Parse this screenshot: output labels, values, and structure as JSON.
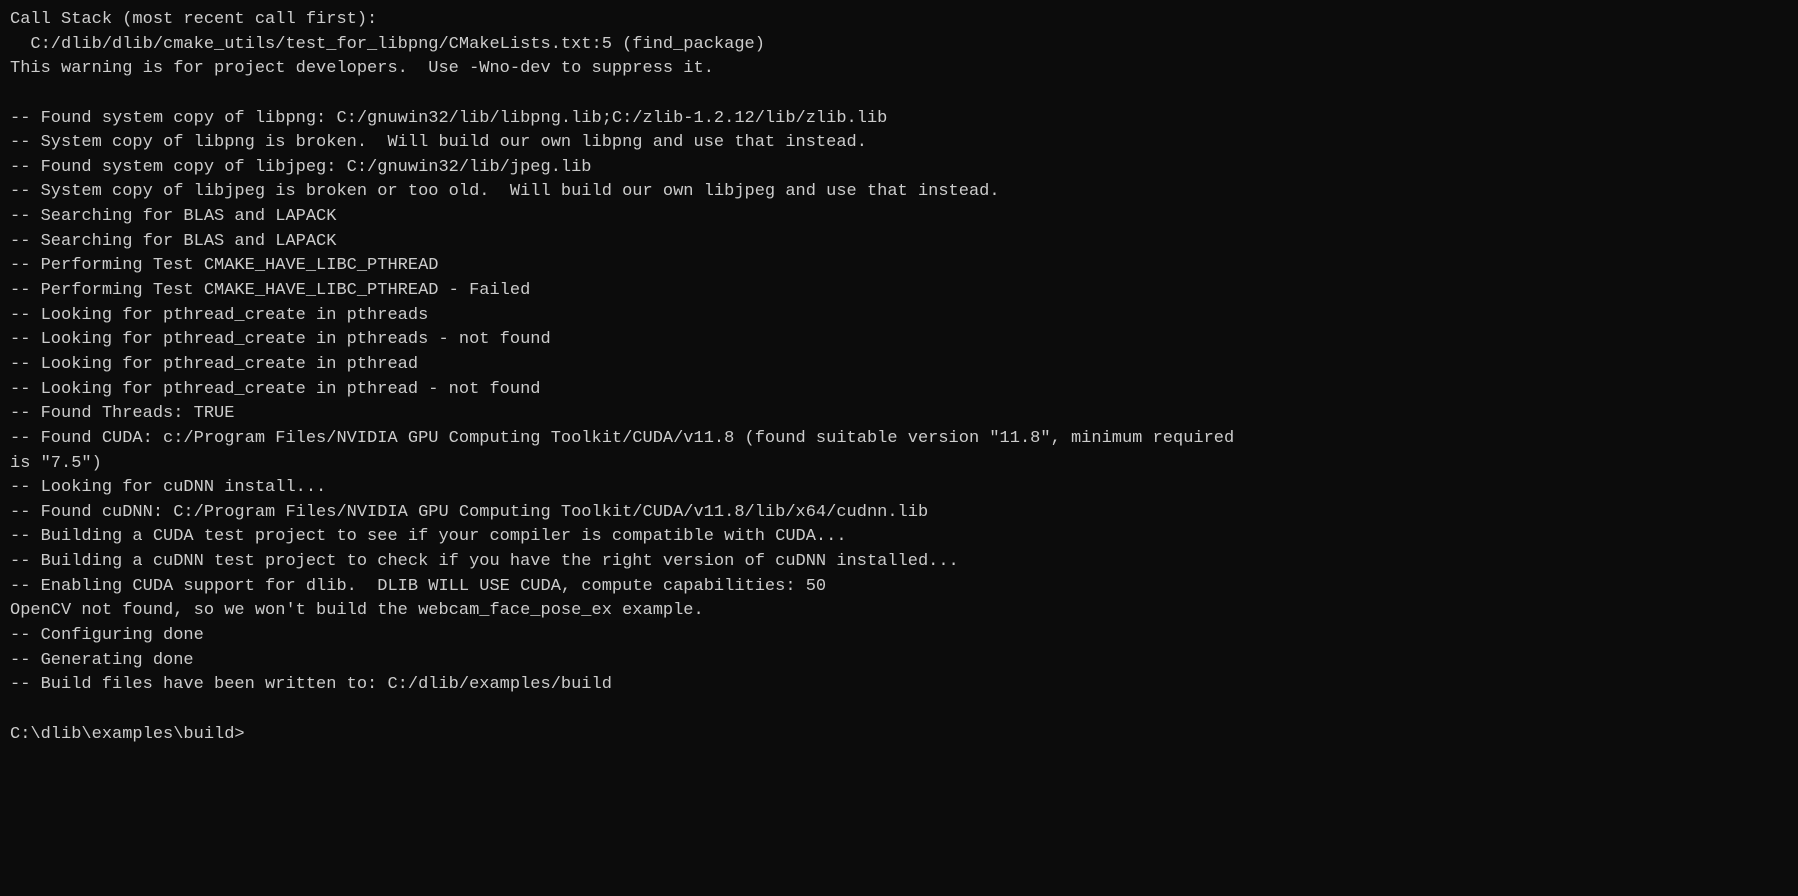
{
  "terminal": {
    "lines": [
      "Call Stack (most recent call first):",
      "  C:/dlib/dlib/cmake_utils/test_for_libpng/CMakeLists.txt:5 (find_package)",
      "This warning is for project developers.  Use -Wno-dev to suppress it.",
      "",
      "-- Found system copy of libpng: C:/gnuwin32/lib/libpng.lib;C:/zlib-1.2.12/lib/zlib.lib",
      "-- System copy of libpng is broken.  Will build our own libpng and use that instead.",
      "-- Found system copy of libjpeg: C:/gnuwin32/lib/jpeg.lib",
      "-- System copy of libjpeg is broken or too old.  Will build our own libjpeg and use that instead.",
      "-- Searching for BLAS and LAPACK",
      "-- Searching for BLAS and LAPACK",
      "-- Performing Test CMAKE_HAVE_LIBC_PTHREAD",
      "-- Performing Test CMAKE_HAVE_LIBC_PTHREAD - Failed",
      "-- Looking for pthread_create in pthreads",
      "-- Looking for pthread_create in pthreads - not found",
      "-- Looking for pthread_create in pthread",
      "-- Looking for pthread_create in pthread - not found",
      "-- Found Threads: TRUE",
      "-- Found CUDA: c:/Program Files/NVIDIA GPU Computing Toolkit/CUDA/v11.8 (found suitable version \"11.8\", minimum required",
      "is \"7.5\")",
      "-- Looking for cuDNN install...",
      "-- Found cuDNN: C:/Program Files/NVIDIA GPU Computing Toolkit/CUDA/v11.8/lib/x64/cudnn.lib",
      "-- Building a CUDA test project to see if your compiler is compatible with CUDA...",
      "-- Building a cuDNN test project to check if you have the right version of cuDNN installed...",
      "-- Enabling CUDA support for dlib.  DLIB WILL USE CUDA, compute capabilities: 50",
      "OpenCV not found, so we won't build the webcam_face_pose_ex example.",
      "-- Configuring done",
      "-- Generating done",
      "-- Build files have been written to: C:/dlib/examples/build",
      "",
      "C:\\dlib\\examples\\build>"
    ]
  }
}
